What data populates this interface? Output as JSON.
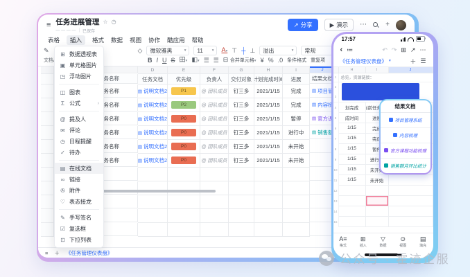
{
  "watermark": {
    "label": "公众号 · 霍迹企服"
  },
  "desktop": {
    "titlebar": {
      "title": "任务进展管理",
      "meta_dashes": "— — — —",
      "saved_status": "已保存",
      "share_label": "分享",
      "present_label": "演示"
    },
    "menubar": {
      "items": [
        "表格",
        "插入",
        "格式",
        "数据",
        "视图",
        "协作",
        "酷应用",
        "帮助"
      ],
      "active_item": "插入"
    },
    "toolbar": {
      "left_label": "文档A",
      "font_name": "微软雅黑",
      "font_size": "11",
      "overflow_label": "溢出",
      "number_format_label": "常规",
      "merge_label": "合并单元格",
      "conditional_label": "条件格式",
      "duplicate_label": "重复项"
    },
    "insert_menu": {
      "highlighted_item": "在线文档",
      "groups": [
        {
          "items": [
            {
              "label": "数据透视表"
            },
            {
              "label": "单元格图片"
            },
            {
              "label": "浮动图片"
            }
          ]
        },
        {
          "items": [
            {
              "label": "图表"
            },
            {
              "label": "公式"
            }
          ]
        },
        {
          "items": [
            {
              "label": "提及人"
            },
            {
              "label": "评论"
            },
            {
              "label": "日程提醒"
            },
            {
              "label": "待办"
            }
          ]
        },
        {
          "items": [
            {
              "label": "在线文档"
            },
            {
              "label": "链接"
            },
            {
              "label": "附件"
            },
            {
              "label": "表态接龙"
            }
          ]
        },
        {
          "items": [
            {
              "label": "手写签名"
            },
            {
              "label": "复选框"
            },
            {
              "label": "下拉列表"
            }
          ]
        }
      ]
    },
    "sheet": {
      "column_letters": [
        "C",
        "D",
        "E",
        "F",
        "G",
        "H",
        "I",
        "J"
      ],
      "headers": [
        "任务名称",
        "任务文档",
        "优先级",
        "负责人",
        "交付对象",
        "计划完成时间",
        "进展",
        "结果文档"
      ],
      "rows": [
        {
          "name": "任务名称",
          "doc": "说明文档2",
          "priority": "P1",
          "owner": "@ 团队成员",
          "target": "钉三多",
          "due": "2021/1/15",
          "progress": "完成",
          "result": "项目管理系统"
        },
        {
          "name": "任务名称",
          "doc": "说明文档2",
          "priority": "P2",
          "owner": "@ 团队成员",
          "target": "钉三多",
          "due": "2021/1/15",
          "progress": "完成",
          "result": "内容梳理"
        },
        {
          "name": "任务名称",
          "doc": "说明文档2",
          "priority": "P0",
          "owner": "@ 团队成员",
          "target": "钉三多",
          "due": "2021/1/15",
          "progress": "暂停",
          "result": "官方课程功能梳理"
        },
        {
          "name": "任务名称",
          "doc": "说明文档2",
          "priority": "P0",
          "owner": "@ 团队成员",
          "target": "钉三多",
          "due": "2021/1/15",
          "progress": "进行中",
          "result": "销售额月环比统计"
        },
        {
          "name": "任务名称",
          "doc": "说明文档2",
          "priority": "P0",
          "owner": "@ 团队成员",
          "target": "钉三多",
          "due": "2021/1/15",
          "progress": "未开始",
          "result": ""
        },
        {
          "name": "任务名称",
          "doc": "说明文档2",
          "priority": "P0",
          "owner": "@ 团队成员",
          "target": "钉三多",
          "due": "2021/1/15",
          "progress": "未开始",
          "result": ""
        }
      ]
    },
    "bottombar": {
      "sheet_tab": "《任务管理仪表盘》"
    },
    "colors": {
      "accent_blue": "#3370ff",
      "priority_p0": "#e96d52",
      "priority_p1": "#f7c64d",
      "priority_p2": "#9ac97e",
      "link_purple": "#7a4df0",
      "link_teal": "#00a3a3"
    }
  },
  "phone": {
    "status_time": "17:57",
    "sheet_tab": "《任务管理仪表盘》",
    "column_letters": [
      "H",
      "I",
      "J"
    ],
    "note_row_number": "1",
    "note_text": "总览，资源链接：",
    "banner_row_numbers": [
      "2",
      "3"
    ],
    "banner_color": "#2b50dd",
    "table_rows": [
      {
        "n": "4",
        "c1": "划完成",
        "c2": "当前任务总览"
      },
      {
        "n": "5",
        "c1": "成时间",
        "c2": "进展"
      },
      {
        "n": "6",
        "c1": "1/15",
        "c2": "完成"
      },
      {
        "n": "7",
        "c1": "1/15",
        "c2": "完成"
      },
      {
        "n": "8",
        "c1": "1/15",
        "c2": "暂停"
      },
      {
        "n": "9",
        "c1": "1/15",
        "c2": "进行中"
      },
      {
        "n": "10",
        "c1": "1/15",
        "c2": "未开始"
      },
      {
        "n": "11",
        "c1": "1/15",
        "c2": "未开始"
      },
      {
        "n": "12",
        "c1": "",
        "c2": ""
      },
      {
        "n": "13",
        "c1": "",
        "c2": ""
      },
      {
        "n": "14",
        "c1": "",
        "c2": ""
      },
      {
        "n": "15",
        "c1": "",
        "c2": ""
      }
    ],
    "callout": {
      "title": "结果文档",
      "items": [
        {
          "label": "项目管理系统",
          "color": "#3370ff"
        },
        {
          "label": "内容梳理",
          "color": "#3370ff"
        },
        {
          "label": "官方课程功能梳理",
          "color": "#7a4df0"
        },
        {
          "label": "销售额月环比统计",
          "color": "#00a3a3"
        }
      ]
    },
    "toolbar_items": [
      {
        "label": "格式"
      },
      {
        "label": "插入"
      },
      {
        "label": "数据"
      },
      {
        "label": "视图"
      },
      {
        "label": "填充"
      }
    ]
  }
}
